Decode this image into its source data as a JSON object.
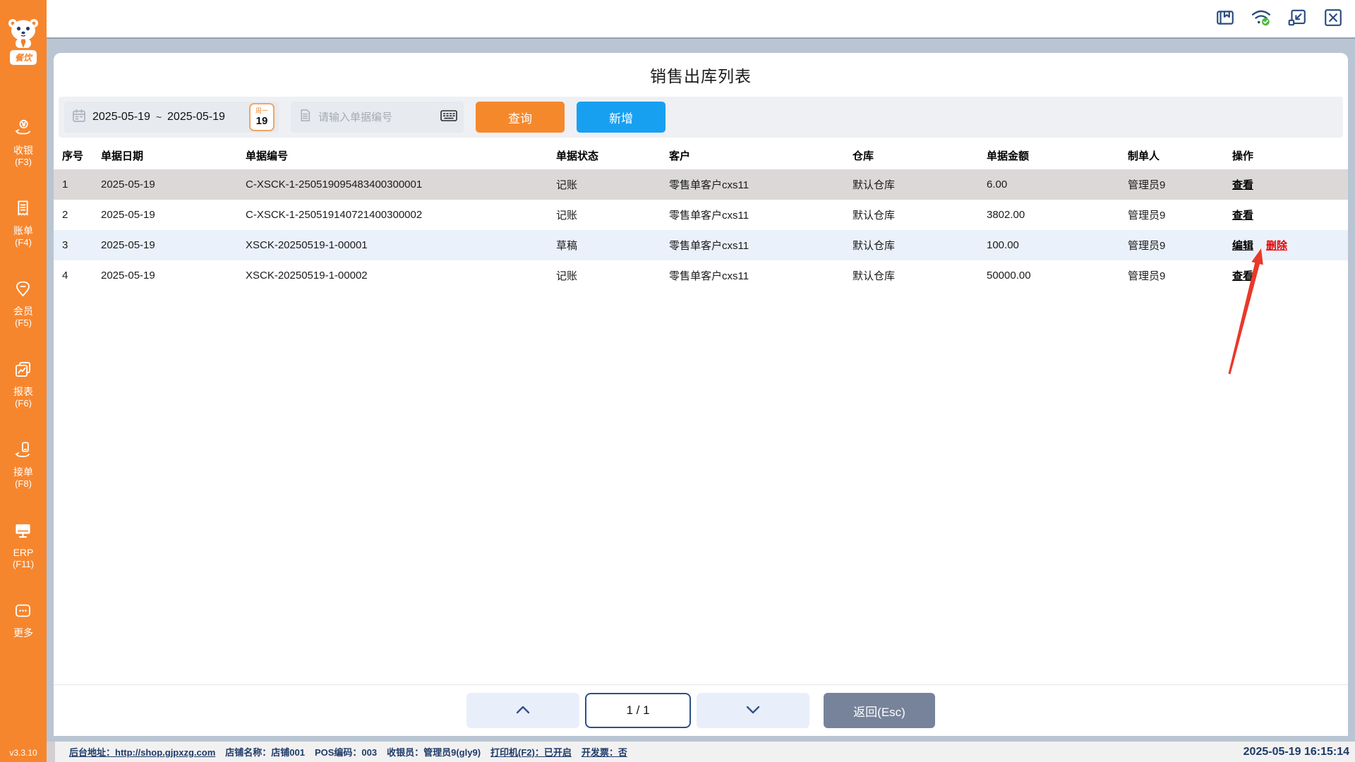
{
  "app": {
    "version": "v3.3.10",
    "brand": "餐饮"
  },
  "colors": {
    "accent_orange": "#F6862E",
    "accent_blue": "#18A0F0",
    "navy": "#2B4C7E",
    "delete_red": "#E60000",
    "annotation_red": "#E8392A",
    "row_selected": "#DCD8D8",
    "row_highlight": "#EBF1FA"
  },
  "sidebar": {
    "items": [
      {
        "label": "收银",
        "hotkey": "(F3)",
        "icon": "cashier-icon"
      },
      {
        "label": "账单",
        "hotkey": "(F4)",
        "icon": "bill-icon"
      },
      {
        "label": "会员",
        "hotkey": "(F5)",
        "icon": "member-icon"
      },
      {
        "label": "报表",
        "hotkey": "(F6)",
        "icon": "report-icon"
      },
      {
        "label": "接单",
        "hotkey": "(F8)",
        "icon": "orders-icon"
      },
      {
        "label": "ERP",
        "hotkey": "(F11)",
        "icon": "erp-icon"
      },
      {
        "label": "更多",
        "hotkey": "",
        "icon": "more-icon"
      }
    ]
  },
  "titlebar": {
    "icons": [
      "manual-icon",
      "network-icon",
      "restore-icon",
      "close-icon"
    ]
  },
  "page": {
    "title": "销售出库列表"
  },
  "filters": {
    "date_from": "2025-05-19",
    "range_sep": "~",
    "date_to": "2025-05-19",
    "calendar_weekday": "周一",
    "calendar_day": "19",
    "search_placeholder": "请输入单据编号",
    "query_label": "查询",
    "add_label": "新增"
  },
  "table": {
    "columns": [
      "序号",
      "单据日期",
      "单据编号",
      "单据状态",
      "客户",
      "仓库",
      "单据金额",
      "制单人",
      "操作"
    ],
    "rows": [
      {
        "seq": "1",
        "date": "2025-05-19",
        "no": "C-XSCK-1-250519095483400300001",
        "status": "记账",
        "customer": "零售单客户cxs11",
        "warehouse": "默认仓库",
        "amount": "6.00",
        "creator": "管理员9",
        "actions": [
          "查看"
        ]
      },
      {
        "seq": "2",
        "date": "2025-05-19",
        "no": "C-XSCK-1-250519140721400300002",
        "status": "记账",
        "customer": "零售单客户cxs11",
        "warehouse": "默认仓库",
        "amount": "3802.00",
        "creator": "管理员9",
        "actions": [
          "查看"
        ]
      },
      {
        "seq": "3",
        "date": "2025-05-19",
        "no": "XSCK-20250519-1-00001",
        "status": "草稿",
        "customer": "零售单客户cxs11",
        "warehouse": "默认仓库",
        "amount": "100.00",
        "creator": "管理员9",
        "actions": [
          "编辑",
          "删除"
        ]
      },
      {
        "seq": "4",
        "date": "2025-05-19",
        "no": "XSCK-20250519-1-00002",
        "status": "记账",
        "customer": "零售单客户cxs11",
        "warehouse": "默认仓库",
        "amount": "50000.00",
        "creator": "管理员9",
        "actions": [
          "查看"
        ]
      }
    ]
  },
  "pagination": {
    "page": "1 / 1",
    "back_label": "返回(Esc)"
  },
  "statusbar": {
    "backend": "后台地址：http://shop.gjpxzg.com",
    "shop": "店铺名称：店铺001",
    "pos": "POS编码：003",
    "cashier": "收银员：管理员9(gly9)",
    "printer": "打印机(F2)：已开启",
    "invoice": "开发票：否",
    "datetime": "2025-05-19 16:15:14"
  }
}
